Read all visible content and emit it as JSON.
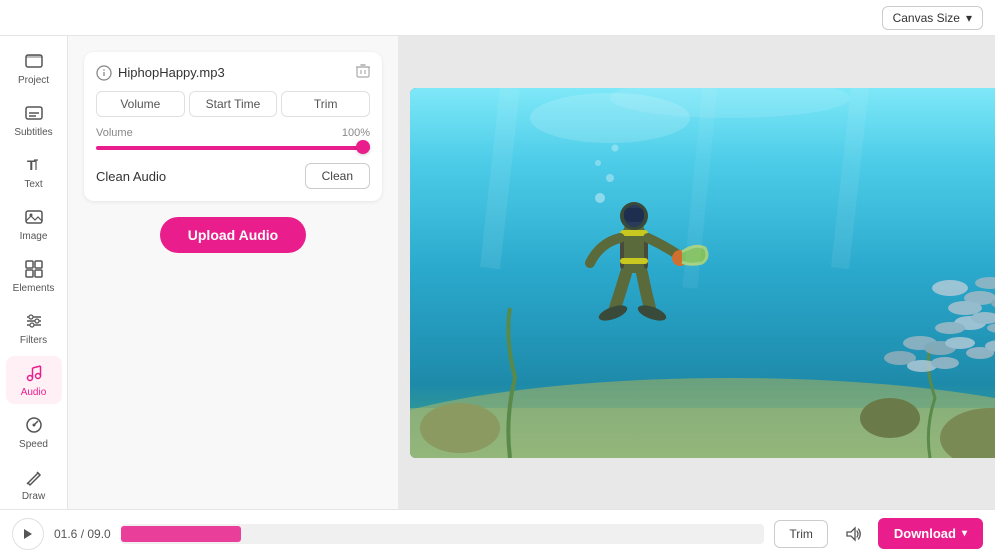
{
  "topbar": {
    "canvas_size_label": "Canvas Size"
  },
  "sidebar": {
    "items": [
      {
        "id": "project",
        "label": "Project",
        "icon": "🎬"
      },
      {
        "id": "subtitles",
        "label": "Subtitles",
        "icon": "💬"
      },
      {
        "id": "text",
        "label": "Text",
        "icon": "T"
      },
      {
        "id": "image",
        "label": "Image",
        "icon": "🖼"
      },
      {
        "id": "elements",
        "label": "Elements",
        "icon": "✦"
      },
      {
        "id": "filters",
        "label": "Filters",
        "icon": "≡"
      },
      {
        "id": "audio",
        "label": "Audio",
        "icon": "♪"
      },
      {
        "id": "speed",
        "label": "Speed",
        "icon": "⏱"
      },
      {
        "id": "draw",
        "label": "Draw",
        "icon": "✏"
      }
    ]
  },
  "panel": {
    "audio_filename": "HiphopHappy.mp3",
    "tabs": [
      {
        "label": "Volume"
      },
      {
        "label": "Start Time"
      },
      {
        "label": "Trim"
      }
    ],
    "volume_label": "Volume",
    "volume_value": "100%",
    "clean_audio_label": "Clean Audio",
    "clean_btn_label": "Clean",
    "upload_btn_label": "Upload Audio"
  },
  "bottombar": {
    "current_time": "01.6",
    "total_time": "09.0",
    "trim_label": "Trim",
    "download_label": "Download"
  }
}
